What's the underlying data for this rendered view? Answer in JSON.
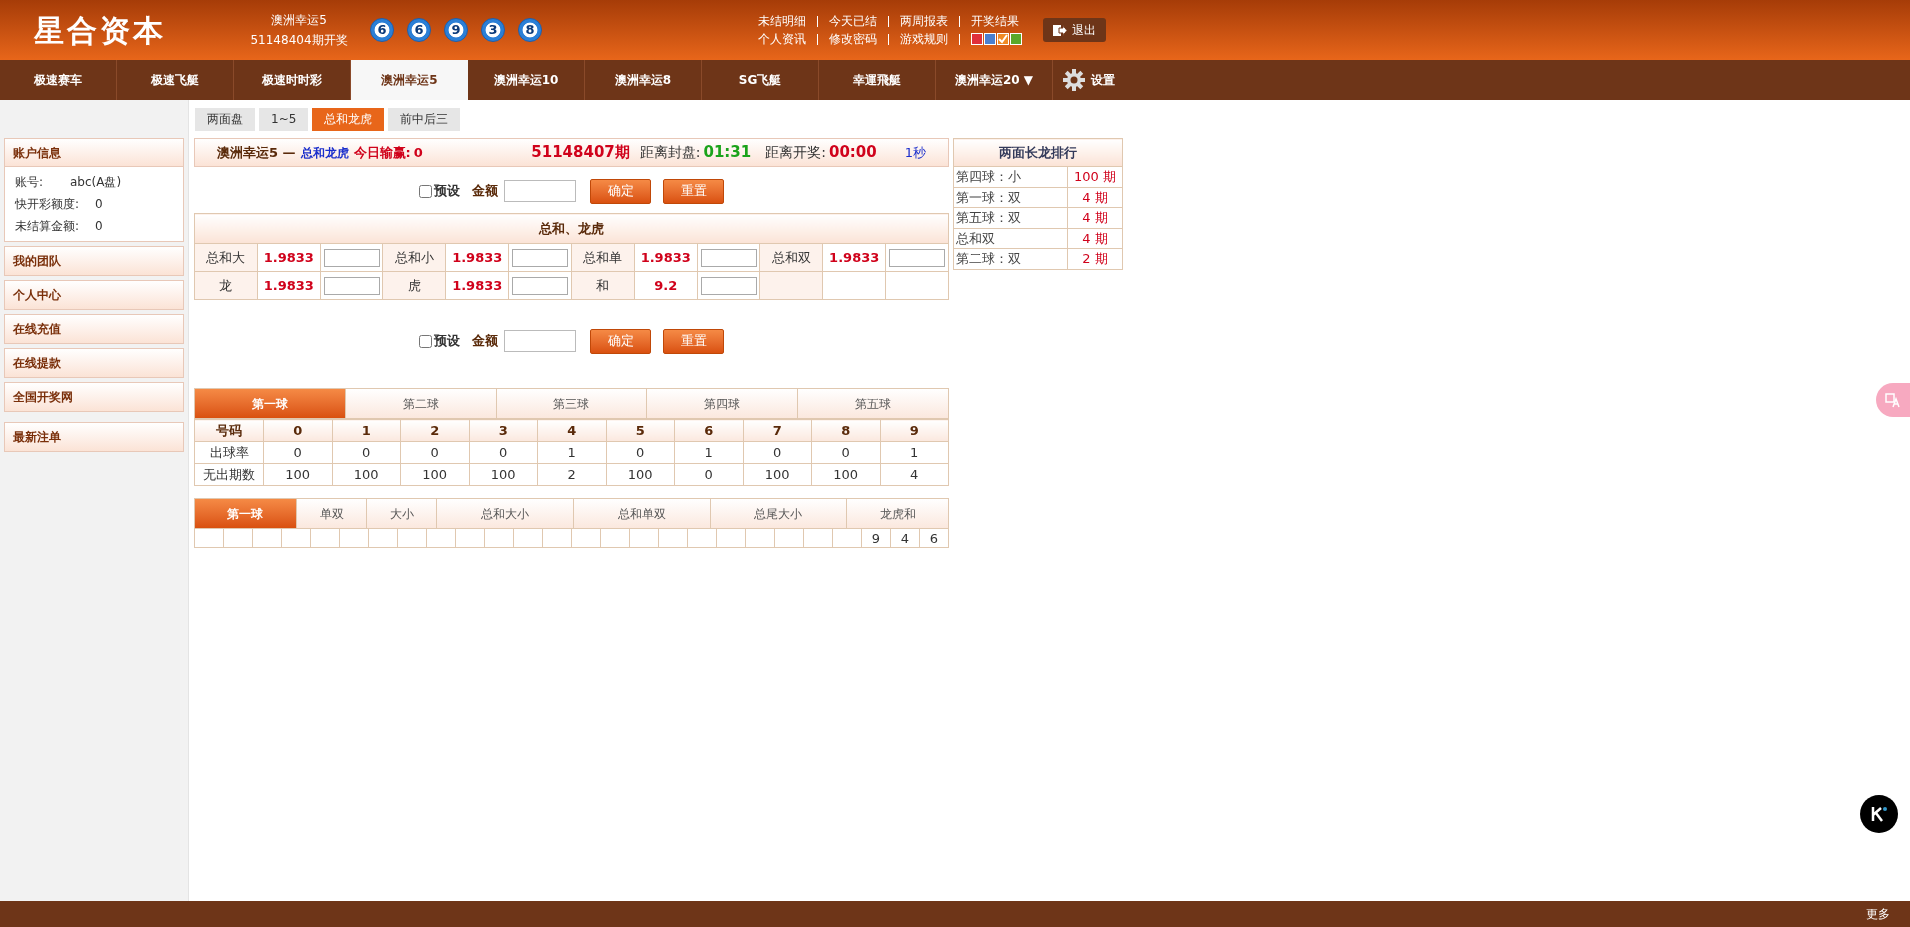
{
  "header": {
    "logo": "星合资本",
    "lottery": "澳洲幸运5",
    "issue": "51148404期开奖",
    "balls": [
      "6",
      "6",
      "9",
      "3",
      "8"
    ],
    "links_row_1": [
      "未结明细",
      "今天已结",
      "两周报表",
      "开奖结果"
    ],
    "links_row_2": [
      "个人资讯",
      "修改密码",
      "游戏规则"
    ],
    "themes": [
      {
        "color": "#e0303a",
        "selected": false
      },
      {
        "color": "#4a7fd0",
        "selected": false
      },
      {
        "color": "#f08a24",
        "selected": true
      },
      {
        "color": "#5aa82a",
        "selected": false
      }
    ],
    "logout": "退出"
  },
  "nav": {
    "items": [
      {
        "label": "极速赛车",
        "selected": false
      },
      {
        "label": "极速飞艇",
        "selected": false
      },
      {
        "label": "极速时时彩",
        "selected": false
      },
      {
        "label": "澳洲幸运5",
        "selected": true
      },
      {
        "label": "澳洲幸运10",
        "selected": false
      },
      {
        "label": "澳洲幸运8",
        "selected": false
      },
      {
        "label": "SG飞艇",
        "selected": false
      },
      {
        "label": "幸運飛艇",
        "selected": false
      },
      {
        "label": "澳洲幸运20 ▼",
        "selected": false
      }
    ],
    "settings": "设置"
  },
  "sub_tabs": [
    {
      "label": "两面盘",
      "selected": false
    },
    {
      "label": "1~5",
      "selected": false
    },
    {
      "label": "总和龙虎",
      "selected": true
    },
    {
      "label": "前中后三",
      "selected": false
    }
  ],
  "sidebar": {
    "account": {
      "title": "账户信息",
      "fields": [
        {
          "label": "账号:",
          "value": "abc(A盘)"
        },
        {
          "label": "快开彩额度:",
          "value": "0"
        },
        {
          "label": "未结算金额:",
          "value": "0"
        }
      ]
    },
    "menu": [
      "我的团队",
      "个人中心",
      "在线充值",
      "在线提款",
      "全国开奖网"
    ],
    "latest": "最新注单"
  },
  "info_bar": {
    "game": "澳洲幸运5 —",
    "play": "总和龙虎",
    "today_label": "今日输赢:",
    "today_value": "0",
    "period": "51148407期",
    "close_label": "距离封盘:",
    "close_time": "01:31",
    "draw_label": "距离开奖:",
    "draw_time": "00:00",
    "refresh": "1秒"
  },
  "bet_controls": [
    {
      "preset_label": "预设",
      "checked": false,
      "amount_label": "金额",
      "confirm": "确定",
      "reset": "重置"
    },
    {
      "preset_label": "预设",
      "checked": false,
      "amount_label": "金额",
      "confirm": "确定",
      "reset": "重置"
    }
  ],
  "odds_table": {
    "title": "总和、龙虎",
    "rows": [
      [
        {
          "label": "总和大",
          "odds": "1.9833"
        },
        {
          "label": "总和小",
          "odds": "1.9833"
        },
        {
          "label": "总和单",
          "odds": "1.9833"
        },
        {
          "label": "总和双",
          "odds": "1.9833"
        }
      ],
      [
        {
          "label": "龙",
          "odds": "1.9833"
        },
        {
          "label": "虎",
          "odds": "1.9833"
        },
        {
          "label": "和",
          "odds": "9.2"
        }
      ]
    ]
  },
  "ball_tabs": [
    {
      "label": "第一球",
      "selected": true
    },
    {
      "label": "第二球",
      "selected": false
    },
    {
      "label": "第三球",
      "selected": false
    },
    {
      "label": "第四球",
      "selected": false
    },
    {
      "label": "第五球",
      "selected": false
    }
  ],
  "stats_table": {
    "columns": [
      "号码",
      "0",
      "1",
      "2",
      "3",
      "4",
      "5",
      "6",
      "7",
      "8",
      "9"
    ],
    "rows": [
      [
        "出球率",
        "0",
        "0",
        "0",
        "0",
        "1",
        "0",
        "1",
        "0",
        "0",
        "1"
      ],
      [
        "无出期数",
        "100",
        "100",
        "100",
        "100",
        "2",
        "100",
        "0",
        "100",
        "100",
        "4"
      ]
    ]
  },
  "trend_tabs": [
    {
      "label": "第一球",
      "selected": true
    },
    {
      "label": "单双",
      "selected": false
    },
    {
      "label": "大小",
      "selected": false
    },
    {
      "label": "总和大小",
      "selected": false
    },
    {
      "label": "总和单双",
      "selected": false
    },
    {
      "label": "总尾大小",
      "selected": false
    },
    {
      "label": "龙虎和",
      "selected": false
    }
  ],
  "trend_cells": [
    "9",
    "4",
    "6"
  ],
  "ranking": {
    "title": "两面长龙排行",
    "rows": [
      {
        "item": "第四球：小",
        "count": "100 期"
      },
      {
        "item": "第一球：双",
        "count": "4 期"
      },
      {
        "item": "第五球：双",
        "count": "4 期"
      },
      {
        "item": "总和双",
        "count": "4 期"
      },
      {
        "item": "第二球：双",
        "count": "2 期"
      }
    ]
  },
  "footer": {
    "more": "更多"
  }
}
